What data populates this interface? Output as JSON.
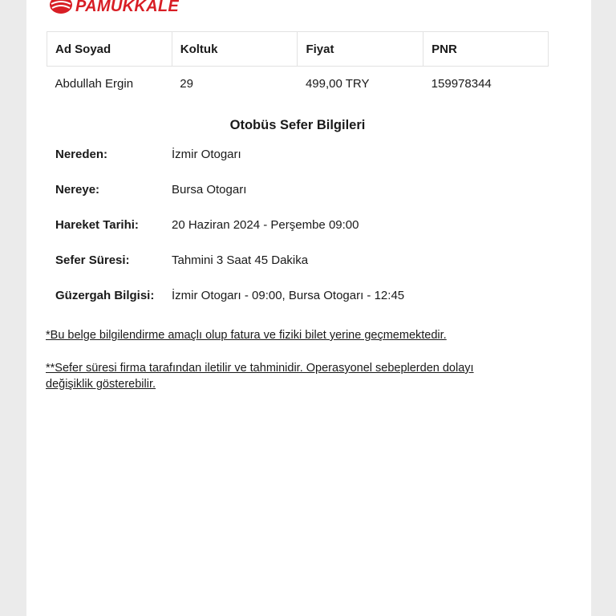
{
  "logo": {
    "text": "PAMUKKALE",
    "color": "#d81e25"
  },
  "passenger_table": {
    "headers": [
      "Ad Soyad",
      "Koltuk",
      "Fiyat",
      "PNR"
    ],
    "rows": [
      [
        "Abdullah Ergin",
        "29",
        "499,00 TRY",
        "159978344"
      ]
    ]
  },
  "trip_info": {
    "title": "Otobüs Sefer Bilgileri",
    "rows": [
      {
        "label": "Nereden:",
        "value": "İzmir Otogarı"
      },
      {
        "label": "Nereye:",
        "value": "Bursa Otogarı"
      },
      {
        "label": "Hareket Tarihi:",
        "value": "20 Haziran 2024 - Perşembe 09:00"
      },
      {
        "label": "Sefer Süresi:",
        "value": "Tahmini 3 Saat 45 Dakika"
      },
      {
        "label": "Güzergah Bilgisi:",
        "value": "İzmir Otogarı - 09:00, Bursa Otogarı - 12:45"
      }
    ]
  },
  "notes": [
    "*Bu belge bilgilendirme amaçlı olup fatura ve fiziki bilet yerine geçmemektedir.",
    "**Sefer süresi firma tarafından iletilir ve tahminidir. Operasyonel sebeplerden dolayı değişiklik gösterebilir."
  ]
}
